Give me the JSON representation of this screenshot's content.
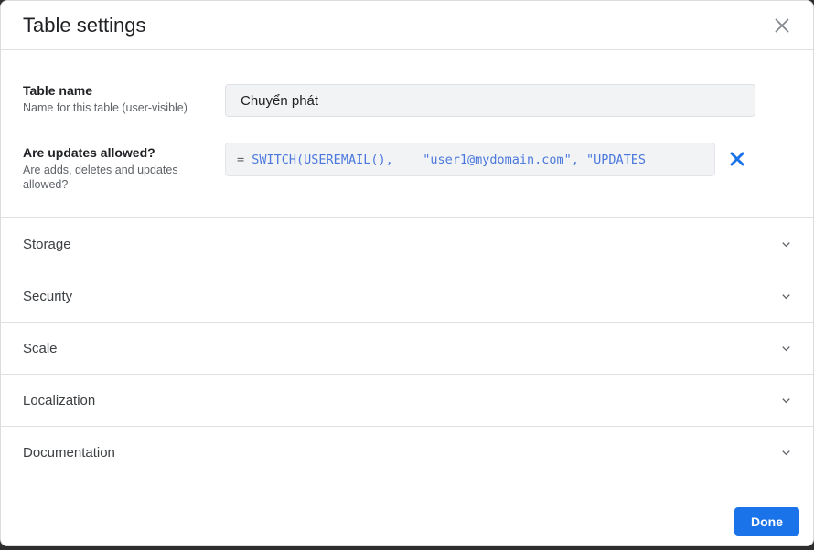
{
  "dialog": {
    "title": "Table settings"
  },
  "fields": {
    "table_name": {
      "label": "Table name",
      "description": "Name for this table (user-visible)",
      "value": "Chuyển phát"
    },
    "updates_allowed": {
      "label": "Are updates allowed?",
      "description": "Are adds, deletes and updates allowed?",
      "equals_sign": "=",
      "formula_visible": "SWITCH(USEREMAIL(),    \"user1@mydomain.com\", \"UPDATES"
    }
  },
  "sections": [
    {
      "label": "Storage"
    },
    {
      "label": "Security"
    },
    {
      "label": "Scale"
    },
    {
      "label": "Localization"
    },
    {
      "label": "Documentation"
    }
  ],
  "footer": {
    "done_label": "Done"
  },
  "colors": {
    "accent_blue": "#1a73e8",
    "formula_blue": "#4c78dd",
    "label_dark": "#202124",
    "muted_gray": "#5f6368",
    "field_background": "#f1f3f4",
    "divider": "#e0e0e0"
  }
}
